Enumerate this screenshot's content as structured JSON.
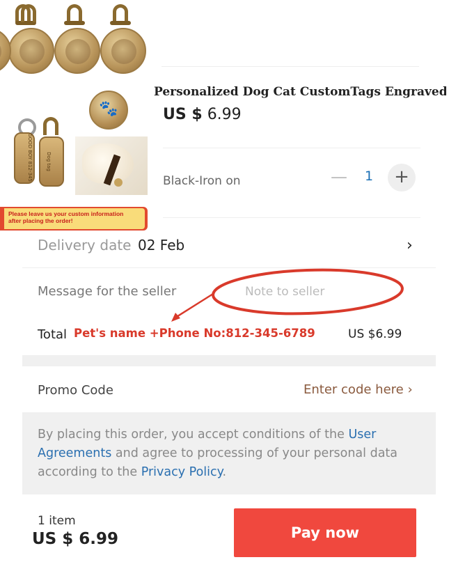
{
  "product": {
    "title": "Personalized Dog Cat CustomTags Engraved .",
    "price_currency": "US $",
    "price_value": "6.99",
    "banner_line1": "Please leave us your custom information",
    "banner_line2": "after placing the order!",
    "image_tag_text": "Dog tag"
  },
  "variant": {
    "label": "Black-Iron on",
    "quantity": "1",
    "minus_glyph": "—",
    "plus_glyph": "+"
  },
  "delivery": {
    "label": "Delivery date",
    "date": "02 Feb",
    "chevron": "›"
  },
  "message": {
    "label": "Message for the seller",
    "placeholder": "Note to seller"
  },
  "annotation": {
    "text": "Pet's name +Phone No:812-345-6789",
    "color": "#d93a2b"
  },
  "total": {
    "label": "Total",
    "value": "US $6.99"
  },
  "promo": {
    "label": "Promo Code",
    "link": "Enter code here ›"
  },
  "agreement": {
    "part1": "By placing this order, you accept conditions of the ",
    "link1": "User Agreements",
    "part2": " and agree to processing of your personal data according to the ",
    "link2": "Privacy Policy",
    "part3": "."
  },
  "footer": {
    "item_count": "1 item",
    "total": "US $ 6.99",
    "pay_label": "Pay now"
  },
  "colors": {
    "pay_button": "#f0483e",
    "link": "#2a6fb0",
    "quantity": "#1a6fb5",
    "promo_link": "#8a5a3e"
  },
  "icons": [
    "paw-icon",
    "minus-icon",
    "plus-icon",
    "chevron-right-icon",
    "annotation-ellipse",
    "annotation-arrow"
  ]
}
